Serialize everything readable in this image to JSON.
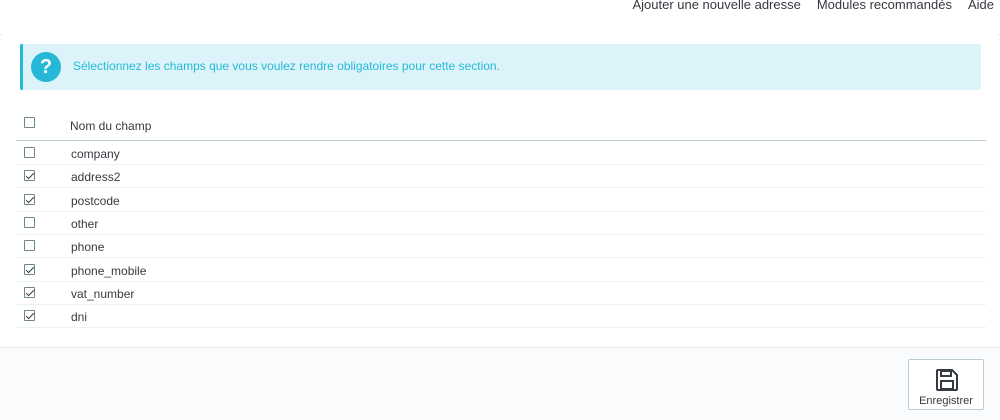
{
  "header": {
    "links": [
      "Ajouter une nouvelle adresse",
      "Modules recommandés",
      "Aide"
    ]
  },
  "alert": {
    "text": "Sélectionnez les champs que vous voulez rendre obligatoires pour cette section.",
    "icon": "question-circle-icon"
  },
  "table": {
    "header": "Nom du champ",
    "select_all_checked": false,
    "rows": [
      {
        "label": "company",
        "checked": false
      },
      {
        "label": "address2",
        "checked": true
      },
      {
        "label": "postcode",
        "checked": true
      },
      {
        "label": "other",
        "checked": false
      },
      {
        "label": "phone",
        "checked": false
      },
      {
        "label": "phone_mobile",
        "checked": true
      },
      {
        "label": "vat_number",
        "checked": true
      },
      {
        "label": "dni",
        "checked": true
      }
    ]
  },
  "footer": {
    "save_label": "Enregistrer",
    "save_icon": "floppy-disk-icon"
  },
  "colors": {
    "accent": "#25b9d7",
    "alert_bg": "#dcf4f9",
    "text": "#363a41"
  }
}
